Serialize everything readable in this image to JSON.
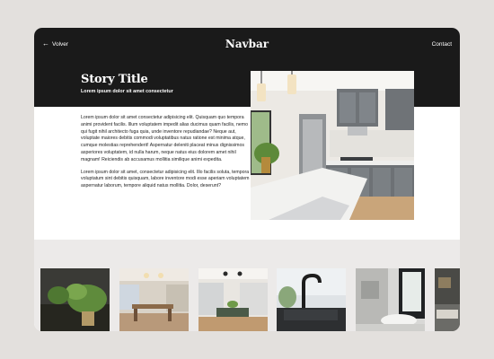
{
  "nav": {
    "back_label": "Volver",
    "brand": "Navbar",
    "contact_label": "Contact"
  },
  "story": {
    "title": "Story Title",
    "subtitle": "Lorem ipsum dolor sit amet consectetur",
    "paragraphs": [
      "Lorem ipsum dolor sit amet consectetur adipisicing elit. Quisquam quo tempora animi provident facilis. Illum voluptatem impedit alias ducimus quam facilis, nemo qui fugit nihil architecto fuga quia, unde inventore repudiandae? Neque aut, voluptate maiores debitis commodi voluptatibus natus ratione est minima atque, cumque molestias reprehenderit! Aspernatur deleniti placeat minus dignissimos asperiores voluptatem, id nulla harum, neque natus eius dolorem amet nihil magnam! Reiciendis ab accusamus mollitia similique animi expedita.",
      "Lorem ipsum dolor sit amet, consectetur adipisicing elit. Illo facilis soluta, tempora voluptatum sint debitis quisquam, labore inventore modi esse aperiam voluptatem aspernatur laborum, tempore aliquid natus mollitia. Dolor, deserunt?"
    ]
  },
  "hero_image": {
    "subject": "modern-kitchen-photo"
  },
  "gallery": [
    {
      "subject": "plant-photo"
    },
    {
      "subject": "dining-room-photo"
    },
    {
      "subject": "open-kitchen-photo"
    },
    {
      "subject": "kitchen-sink-photo"
    },
    {
      "subject": "bathroom-photo"
    },
    {
      "subject": "living-room-photo"
    }
  ],
  "colors": {
    "navbar_bg": "#1a1a1a",
    "page_bg": "#e3e0dd",
    "gallery_bg": "#eceae9"
  }
}
